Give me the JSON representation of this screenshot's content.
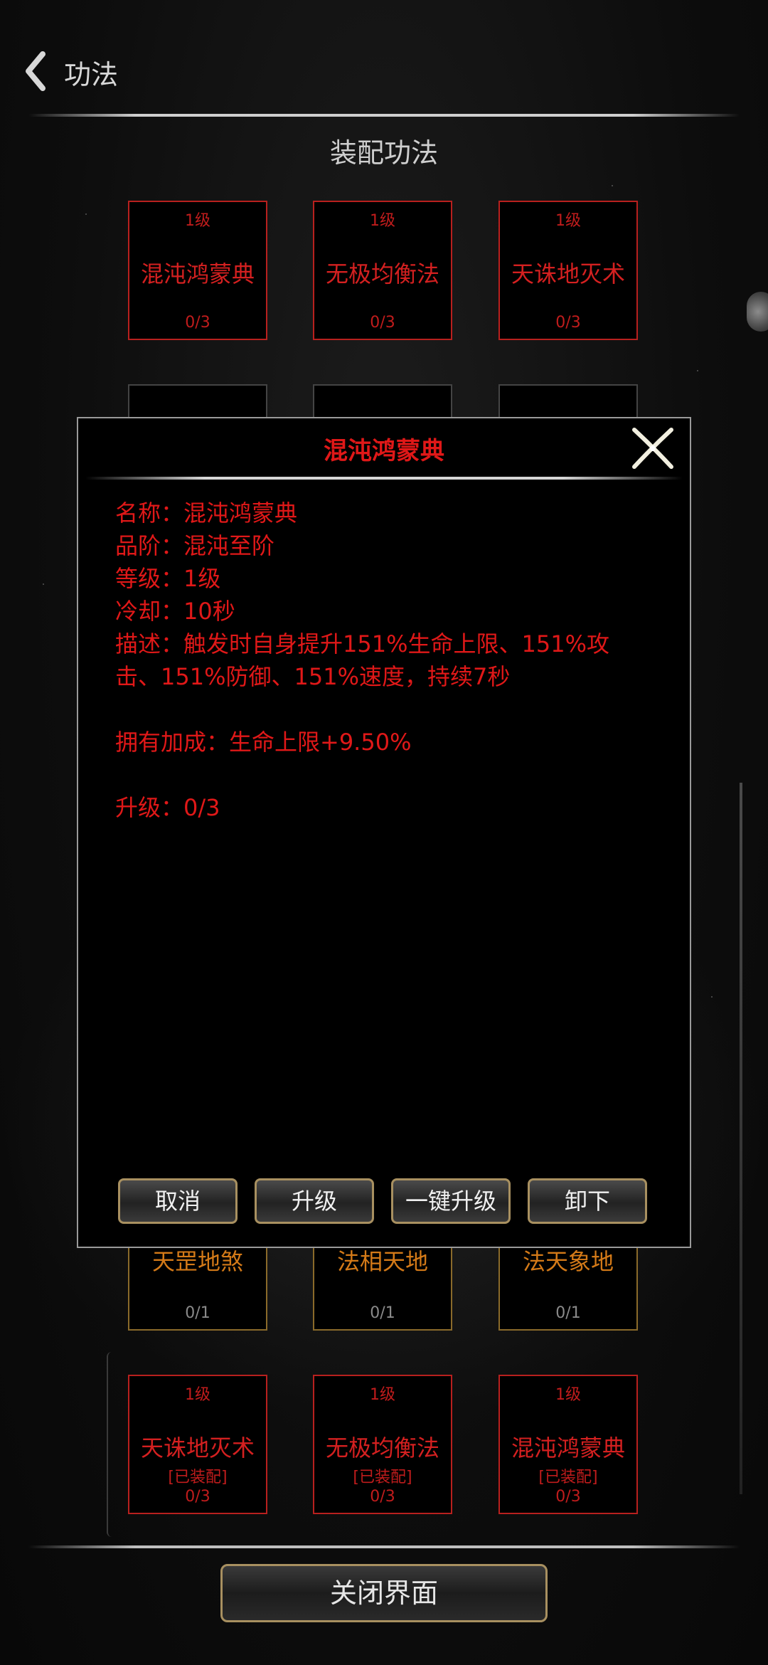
{
  "header": {
    "title": "功法"
  },
  "section": {
    "title": "装配功法"
  },
  "equipped_slots": [
    {
      "level": "1级",
      "name": "混沌鸿蒙典",
      "progress": "0/3"
    },
    {
      "level": "1级",
      "name": "无极均衡法",
      "progress": "0/3"
    },
    {
      "level": "1级",
      "name": "天诛地灭术",
      "progress": "0/3"
    }
  ],
  "gold_slots": [
    {
      "name": "天罡地煞",
      "progress": "0/1"
    },
    {
      "name": "法相天地",
      "progress": "0/1"
    },
    {
      "name": "法天象地",
      "progress": "0/1"
    }
  ],
  "inventory_slots": [
    {
      "level": "1级",
      "name": "天诛地灭术",
      "status": "[已装配]",
      "progress": "0/3"
    },
    {
      "level": "1级",
      "name": "无极均衡法",
      "status": "[已装配]",
      "progress": "0/3"
    },
    {
      "level": "1级",
      "name": "混沌鸿蒙典",
      "status": "[已装配]",
      "progress": "0/3"
    }
  ],
  "modal": {
    "title": "混沌鸿蒙典",
    "lines": {
      "name": "名称：混沌鸿蒙典",
      "grade": "品阶：混沌至阶",
      "level": "等级：1级",
      "cooldown": "冷却：10秒",
      "description": "描述：触发时自身提升151%生命上限、151%攻击、151%防御、151%速度，持续7秒",
      "bonus": "拥有加成：生命上限+9.50%",
      "upgrade": "升级：0/3"
    },
    "buttons": {
      "cancel": "取消",
      "upgrade": "升级",
      "one_click_upgrade": "一键升级",
      "unequip": "卸下"
    }
  },
  "footer": {
    "close_label": "关闭界面"
  },
  "colors": {
    "accent_red": "#e01818",
    "gold_border": "#a89060"
  },
  "icons": {
    "back": "chevron-left-icon",
    "close": "close-x-icon"
  }
}
